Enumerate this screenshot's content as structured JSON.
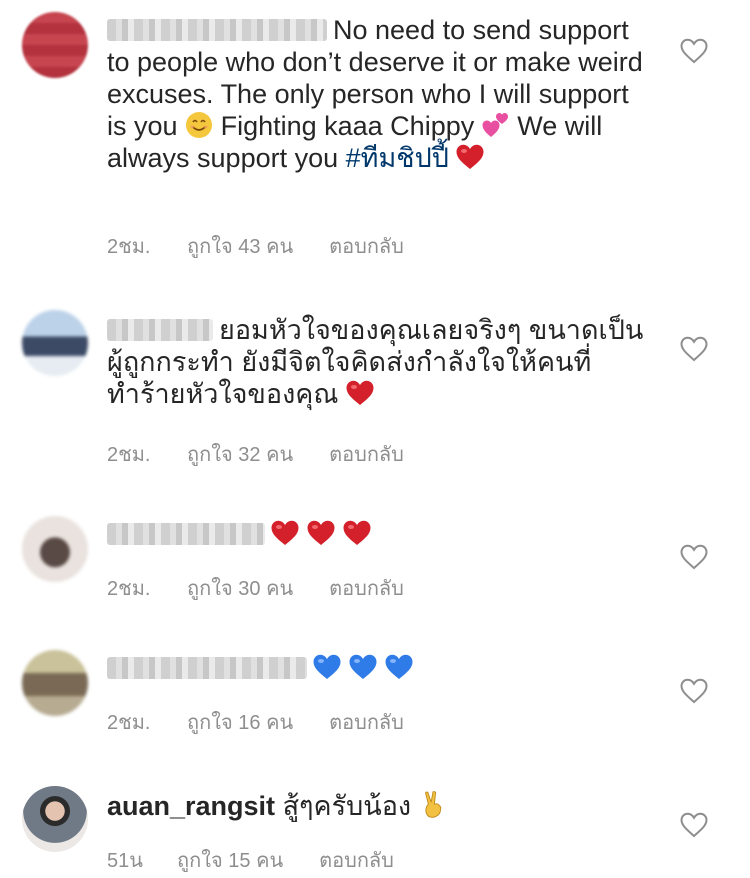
{
  "comments": [
    {
      "text": "No need to send support to people who don’t deserve it or make weird excuses. The only person who I will support is you",
      "text2": "Fighting kaaa Chippy",
      "text3": "We will always support you",
      "hashtag": "#ทีมชิปปี้",
      "time": "2ชม.",
      "likes": "ถูกใจ 43 คน",
      "reply": "ตอบกลับ"
    },
    {
      "text": "ยอมหัวใจของคุณเลยจริงๆ ขนาดเป็นผู้ถูกกระทำ ยังมีจิตใจคิดส่งกำลังใจให้คนที่ทำร้ายหัวใจของคุณ",
      "time": "2ชม.",
      "likes": "ถูกใจ 32 คน",
      "reply": "ตอบกลับ"
    },
    {
      "time": "2ชม.",
      "likes": "ถูกใจ 30 คน",
      "reply": "ตอบกลับ"
    },
    {
      "time": "2ชม.",
      "likes": "ถูกใจ 16 คน",
      "reply": "ตอบกลับ"
    },
    {
      "username": "auan_rangsit",
      "text": "สู้ๆครับน้อง",
      "time": "51น",
      "likes": "ถูกใจ 15 คน",
      "reply": "ตอบกลับ"
    }
  ],
  "colors": {
    "text": "#262626",
    "meta": "#8e8e8e",
    "hashtag": "#00376b",
    "red_heart": "#d4202b",
    "blue_heart": "#2f7be8"
  },
  "icons": [
    "heart-outline-icon",
    "smiling-face-emoji",
    "two-hearts-emoji",
    "red-heart-emoji",
    "blue-heart-emoji",
    "victory-hand-emoji"
  ]
}
